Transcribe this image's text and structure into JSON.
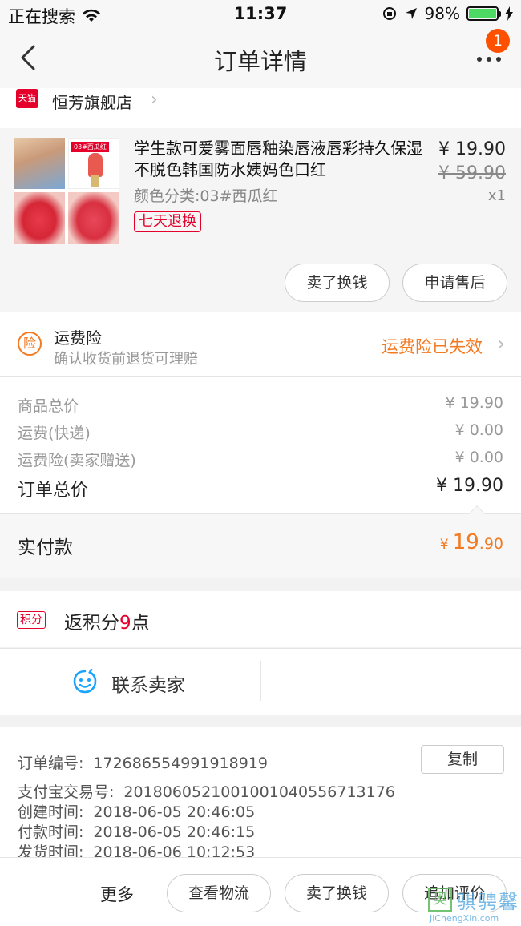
{
  "status_bar": {
    "carrier": "正在搜索",
    "time": "11:37",
    "battery_percent": "98%",
    "battery_level": 0.98
  },
  "nav": {
    "title": "订单详情",
    "badge_count": "1"
  },
  "shop": {
    "logo_text": "天猫",
    "name": "恒芳旗舰店"
  },
  "product": {
    "title": "学生款可爱雾面唇釉染唇液唇彩持久保湿不脱色韩国防水姨妈色口红",
    "sku": "颜色分类:03#西瓜红",
    "tag": "七天退换",
    "price": "¥ 19.90",
    "original_price": "¥ 59.90",
    "quantity": "x1",
    "thumb_label": "03#西瓜红",
    "buttons": {
      "sell": "卖了换钱",
      "after_sale": "申请售后"
    }
  },
  "insurance": {
    "icon_text": "险",
    "title": "运费险",
    "subtitle": "确认收货前退货可理赔",
    "status": "运费险已失效"
  },
  "costs": [
    {
      "label": "商品总价",
      "value": "¥ 19.90"
    },
    {
      "label": "运费(快递)",
      "value": "¥ 0.00"
    },
    {
      "label": "运费险(卖家赠送)",
      "value": "¥ 0.00"
    }
  ],
  "order_total": {
    "label": "订单总价",
    "value": "¥ 19.90"
  },
  "paid": {
    "label": "实付款",
    "currency": "¥",
    "integer": "19",
    "decimal": ".90"
  },
  "points": {
    "tag": "积分",
    "prefix": "返积分",
    "count": "9",
    "suffix": "点"
  },
  "contact": {
    "label": "联系卖家"
  },
  "order_info": {
    "copy_label": "复制",
    "rows": [
      {
        "key": "订单编号:",
        "value": "1726865549919189 19"
      },
      {
        "key": "支付宝交易号:",
        "value": "2018060521001001040556713176"
      },
      {
        "key": "创建时间:",
        "value": "2018-06-05 20:46:05"
      },
      {
        "key": "付款时间:",
        "value": "2018-06-05 20:46:15"
      },
      {
        "key": "发货时间:",
        "value": "2018-06-06 10:12:53"
      }
    ]
  },
  "bottom_bar": {
    "more": "更多",
    "logistics": "查看物流",
    "sell": "卖了换钱",
    "review": "追加评价"
  },
  "watermark": {
    "symbol": "奥",
    "text": "骐骋馨",
    "url": "JiChengXin.com"
  },
  "colors": {
    "accent_orange": "#f27a22",
    "tmall_red": "#e4002b",
    "badge_orange": "#ff5000",
    "contact_blue": "#1aa3ff"
  }
}
